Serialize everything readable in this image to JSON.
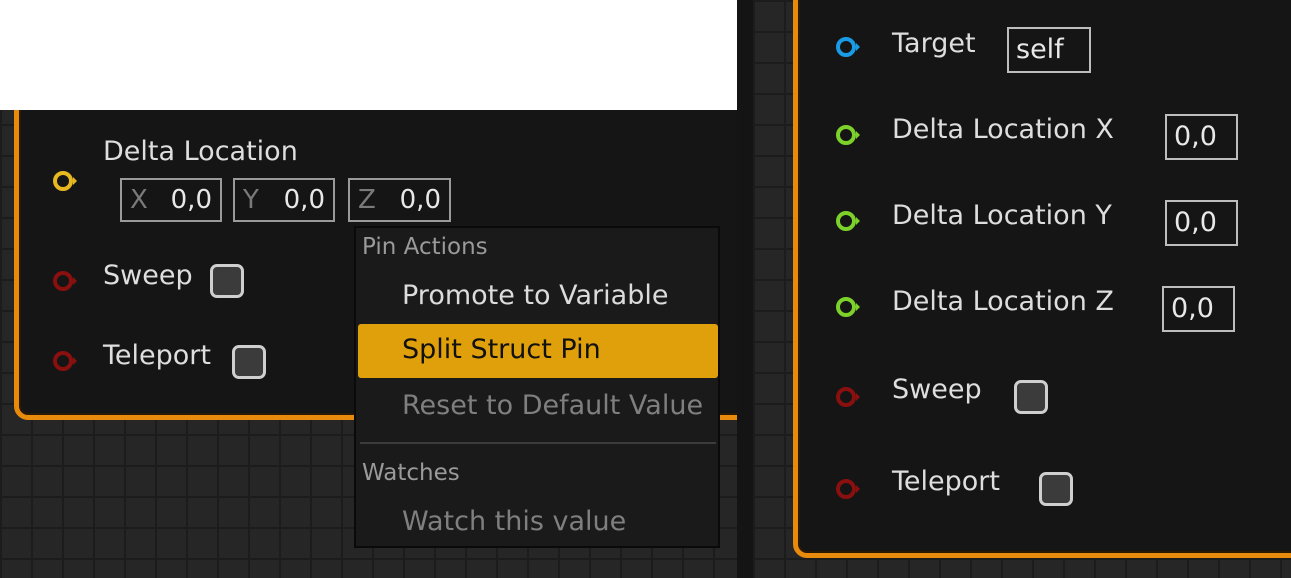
{
  "left_node": {
    "delta_location": {
      "label": "Delta Location",
      "x": {
        "axis": "X",
        "value": "0,0"
      },
      "y": {
        "axis": "Y",
        "value": "0,0"
      },
      "z": {
        "axis": "Z",
        "value": "0,0"
      }
    },
    "sweep": {
      "label": "Sweep"
    },
    "teleport": {
      "label": "Teleport"
    }
  },
  "context_menu": {
    "sections": [
      {
        "header": "Pin Actions",
        "items": [
          {
            "label": "Promote to Variable",
            "state": "enabled"
          },
          {
            "label": "Split Struct Pin",
            "state": "highlighted"
          },
          {
            "label": "Reset to Default Value",
            "state": "disabled"
          }
        ]
      },
      {
        "header": "Watches",
        "items": [
          {
            "label": "Watch this value",
            "state": "disabled"
          }
        ]
      }
    ]
  },
  "right_node": {
    "target": {
      "label": "Target",
      "value": "self"
    },
    "delta_x": {
      "label": "Delta Location X",
      "value": "0,0"
    },
    "delta_y": {
      "label": "Delta Location Y",
      "value": "0,0"
    },
    "delta_z": {
      "label": "Delta Location Z",
      "value": "0,0"
    },
    "sweep": {
      "label": "Sweep"
    },
    "teleport": {
      "label": "Teleport"
    }
  },
  "colors": {
    "node_border": "#e88a0c",
    "highlight": "#e0a00c",
    "pin_struct": "#e8b820",
    "pin_bool": "#8a0f0f",
    "pin_object": "#1a9be6",
    "pin_float": "#7cd12a"
  },
  "icons": [
    "struct-pin-icon",
    "bool-pin-icon",
    "object-pin-icon",
    "float-pin-icon"
  ]
}
